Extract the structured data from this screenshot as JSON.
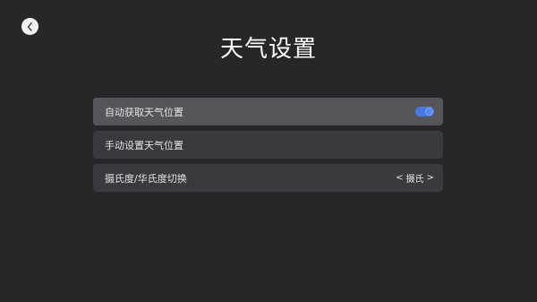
{
  "header": {
    "title": "天气设置"
  },
  "settings": {
    "auto_location_label": "自动获取天气位置",
    "auto_location_enabled": true,
    "manual_location_label": "手动设置天气位置",
    "unit_switch_label": "摄氏度/华氏度切换",
    "unit_prev": "<",
    "unit_value": "摄氏",
    "unit_next": ">"
  },
  "colors": {
    "background": "#27272a",
    "row_focused": "#55555a",
    "row_normal": "#3a3a3e",
    "toggle_on": "#4a78e0"
  }
}
